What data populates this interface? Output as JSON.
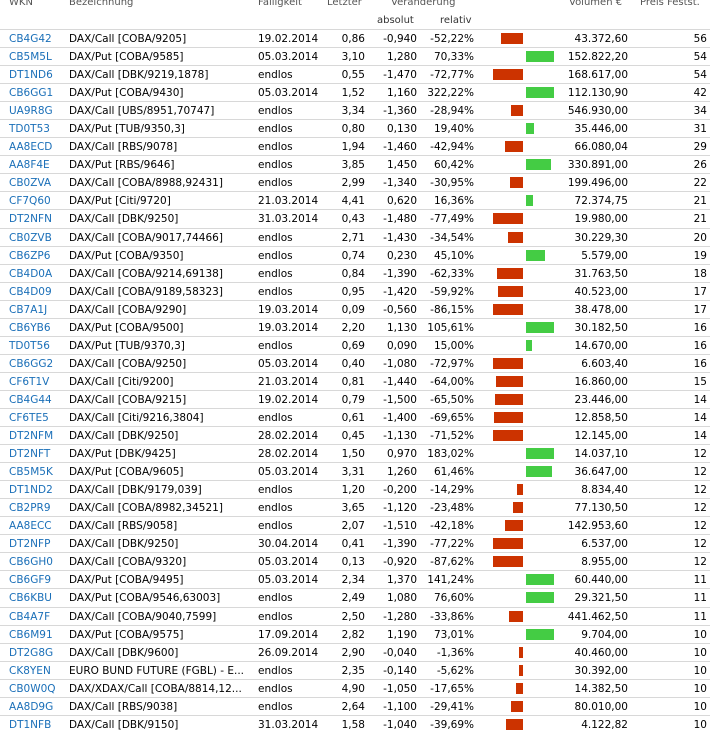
{
  "header": {
    "wkn": "WKN",
    "name": "Bezeichnung",
    "date": "Fälligkeit",
    "last": "Letzter",
    "change": "Veränderung",
    "volume": "Volumen €",
    "fest": "Preis Festst.",
    "abs": "absolut",
    "rel": "relativ"
  },
  "colors": {
    "up": "#44cc44",
    "down": "#cc3300",
    "link": "#1a6fb8"
  },
  "rows": [
    {
      "wkn": "CB4G42",
      "name": "DAX/Call [COBA/9205]",
      "date": "19.02.2014",
      "last": "0,86",
      "abs": "-0,940",
      "rel": "-52,22%",
      "dir": "down",
      "vol": "43.372,60",
      "fest": "56"
    },
    {
      "wkn": "CB5M5L",
      "name": "DAX/Put [COBA/9585]",
      "date": "05.03.2014",
      "last": "3,10",
      "abs": "1,280",
      "rel": "70,33%",
      "dir": "up",
      "vol": "152.822,20",
      "fest": "54"
    },
    {
      "wkn": "DT1ND6",
      "name": "DAX/Call [DBK/9219,1878]",
      "date": "endlos",
      "last": "0,55",
      "abs": "-1,470",
      "rel": "-72,77%",
      "dir": "down",
      "vol": "168.617,00",
      "fest": "54"
    },
    {
      "wkn": "CB6GG1",
      "name": "DAX/Put [COBA/9430]",
      "date": "05.03.2014",
      "last": "1,52",
      "abs": "1,160",
      "rel": "322,22%",
      "dir": "up",
      "vol": "112.130,90",
      "fest": "42"
    },
    {
      "wkn": "UA9R8G",
      "name": "DAX/Call [UBS/8951,70747]",
      "date": "endlos",
      "last": "3,34",
      "abs": "-1,360",
      "rel": "-28,94%",
      "dir": "down",
      "vol": "546.930,00",
      "fest": "34"
    },
    {
      "wkn": "TD0T53",
      "name": "DAX/Put [TUB/9350,3]",
      "date": "endlos",
      "last": "0,80",
      "abs": "0,130",
      "rel": "19,40%",
      "dir": "up",
      "vol": "35.446,00",
      "fest": "31"
    },
    {
      "wkn": "AA8ECD",
      "name": "DAX/Call [RBS/9078]",
      "date": "endlos",
      "last": "1,94",
      "abs": "-1,460",
      "rel": "-42,94%",
      "dir": "down",
      "vol": "66.080,04",
      "fest": "29"
    },
    {
      "wkn": "AA8F4E",
      "name": "DAX/Put [RBS/9646]",
      "date": "endlos",
      "last": "3,85",
      "abs": "1,450",
      "rel": "60,42%",
      "dir": "up",
      "vol": "330.891,00",
      "fest": "26"
    },
    {
      "wkn": "CB0ZVA",
      "name": "DAX/Call [COBA/8988,92431]",
      "date": "endlos",
      "last": "2,99",
      "abs": "-1,340",
      "rel": "-30,95%",
      "dir": "down",
      "vol": "199.496,00",
      "fest": "22"
    },
    {
      "wkn": "CF7Q60",
      "name": "DAX/Put [Citi/9720]",
      "date": "21.03.2014",
      "last": "4,41",
      "abs": "0,620",
      "rel": "16,36%",
      "dir": "up",
      "vol": "72.374,75",
      "fest": "21"
    },
    {
      "wkn": "DT2NFN",
      "name": "DAX/Call [DBK/9250]",
      "date": "31.03.2014",
      "last": "0,43",
      "abs": "-1,480",
      "rel": "-77,49%",
      "dir": "down",
      "vol": "19.980,00",
      "fest": "21"
    },
    {
      "wkn": "CB0ZVB",
      "name": "DAX/Call [COBA/9017,74466]",
      "date": "endlos",
      "last": "2,71",
      "abs": "-1,430",
      "rel": "-34,54%",
      "dir": "down",
      "vol": "30.229,30",
      "fest": "20"
    },
    {
      "wkn": "CB6ZP6",
      "name": "DAX/Put [COBA/9350]",
      "date": "endlos",
      "last": "0,74",
      "abs": "0,230",
      "rel": "45,10%",
      "dir": "up",
      "vol": "5.579,00",
      "fest": "19"
    },
    {
      "wkn": "CB4D0A",
      "name": "DAX/Call [COBA/9214,69138]",
      "date": "endlos",
      "last": "0,84",
      "abs": "-1,390",
      "rel": "-62,33%",
      "dir": "down",
      "vol": "31.763,50",
      "fest": "18"
    },
    {
      "wkn": "CB4D09",
      "name": "DAX/Call [COBA/9189,58323]",
      "date": "endlos",
      "last": "0,95",
      "abs": "-1,420",
      "rel": "-59,92%",
      "dir": "down",
      "vol": "40.523,00",
      "fest": "17"
    },
    {
      "wkn": "CB7A1J",
      "name": "DAX/Call [COBA/9290]",
      "date": "19.03.2014",
      "last": "0,09",
      "abs": "-0,560",
      "rel": "-86,15%",
      "dir": "down",
      "vol": "38.478,00",
      "fest": "17"
    },
    {
      "wkn": "CB6YB6",
      "name": "DAX/Put [COBA/9500]",
      "date": "19.03.2014",
      "last": "2,20",
      "abs": "1,130",
      "rel": "105,61%",
      "dir": "up",
      "vol": "30.182,50",
      "fest": "16"
    },
    {
      "wkn": "TD0T56",
      "name": "DAX/Put [TUB/9370,3]",
      "date": "endlos",
      "last": "0,69",
      "abs": "0,090",
      "rel": "15,00%",
      "dir": "up",
      "vol": "14.670,00",
      "fest": "16"
    },
    {
      "wkn": "CB6GG2",
      "name": "DAX/Call [COBA/9250]",
      "date": "05.03.2014",
      "last": "0,40",
      "abs": "-1,080",
      "rel": "-72,97%",
      "dir": "down",
      "vol": "6.603,40",
      "fest": "16"
    },
    {
      "wkn": "CF6T1V",
      "name": "DAX/Call [Citi/9200]",
      "date": "21.03.2014",
      "last": "0,81",
      "abs": "-1,440",
      "rel": "-64,00%",
      "dir": "down",
      "vol": "16.860,00",
      "fest": "15"
    },
    {
      "wkn": "CB4G44",
      "name": "DAX/Call [COBA/9215]",
      "date": "19.02.2014",
      "last": "0,79",
      "abs": "-1,500",
      "rel": "-65,50%",
      "dir": "down",
      "vol": "23.446,00",
      "fest": "14"
    },
    {
      "wkn": "CF6TE5",
      "name": "DAX/Call [Citi/9216,3804]",
      "date": "endlos",
      "last": "0,61",
      "abs": "-1,400",
      "rel": "-69,65%",
      "dir": "down",
      "vol": "12.858,50",
      "fest": "14"
    },
    {
      "wkn": "DT2NFM",
      "name": "DAX/Call [DBK/9250]",
      "date": "28.02.2014",
      "last": "0,45",
      "abs": "-1,130",
      "rel": "-71,52%",
      "dir": "down",
      "vol": "12.145,00",
      "fest": "14"
    },
    {
      "wkn": "DT2NFT",
      "name": "DAX/Put [DBK/9425]",
      "date": "28.02.2014",
      "last": "1,50",
      "abs": "0,970",
      "rel": "183,02%",
      "dir": "up",
      "vol": "14.037,10",
      "fest": "12"
    },
    {
      "wkn": "CB5M5K",
      "name": "DAX/Put [COBA/9605]",
      "date": "05.03.2014",
      "last": "3,31",
      "abs": "1,260",
      "rel": "61,46%",
      "dir": "up",
      "vol": "36.647,00",
      "fest": "12"
    },
    {
      "wkn": "DT1ND2",
      "name": "DAX/Call [DBK/9179,039]",
      "date": "endlos",
      "last": "1,20",
      "abs": "-0,200",
      "rel": "-14,29%",
      "dir": "down",
      "vol": "8.834,40",
      "fest": "12"
    },
    {
      "wkn": "CB2PR9",
      "name": "DAX/Call [COBA/8982,34521]",
      "date": "endlos",
      "last": "3,65",
      "abs": "-1,120",
      "rel": "-23,48%",
      "dir": "down",
      "vol": "77.130,50",
      "fest": "12"
    },
    {
      "wkn": "AA8ECC",
      "name": "DAX/Call [RBS/9058]",
      "date": "endlos",
      "last": "2,07",
      "abs": "-1,510",
      "rel": "-42,18%",
      "dir": "down",
      "vol": "142.953,60",
      "fest": "12"
    },
    {
      "wkn": "DT2NFP",
      "name": "DAX/Call [DBK/9250]",
      "date": "30.04.2014",
      "last": "0,41",
      "abs": "-1,390",
      "rel": "-77,22%",
      "dir": "down",
      "vol": "6.537,00",
      "fest": "12"
    },
    {
      "wkn": "CB6GH0",
      "name": "DAX/Call [COBA/9320]",
      "date": "05.03.2014",
      "last": "0,13",
      "abs": "-0,920",
      "rel": "-87,62%",
      "dir": "down",
      "vol": "8.955,00",
      "fest": "12"
    },
    {
      "wkn": "CB6GF9",
      "name": "DAX/Put [COBA/9495]",
      "date": "05.03.2014",
      "last": "2,34",
      "abs": "1,370",
      "rel": "141,24%",
      "dir": "up",
      "vol": "60.440,00",
      "fest": "11"
    },
    {
      "wkn": "CB6KBU",
      "name": "DAX/Put [COBA/9546,63003]",
      "date": "endlos",
      "last": "2,49",
      "abs": "1,080",
      "rel": "76,60%",
      "dir": "up",
      "vol": "29.321,50",
      "fest": "11"
    },
    {
      "wkn": "CB4A7F",
      "name": "DAX/Call [COBA/9040,7599]",
      "date": "endlos",
      "last": "2,50",
      "abs": "-1,280",
      "rel": "-33,86%",
      "dir": "down",
      "vol": "441.462,50",
      "fest": "11"
    },
    {
      "wkn": "CB6M91",
      "name": "DAX/Put [COBA/9575]",
      "date": "17.09.2014",
      "last": "2,82",
      "abs": "1,190",
      "rel": "73,01%",
      "dir": "up",
      "vol": "9.704,00",
      "fest": "10"
    },
    {
      "wkn": "DT2G8G",
      "name": "DAX/Call [DBK/9600]",
      "date": "26.09.2014",
      "last": "2,90",
      "abs": "-0,040",
      "rel": "-1,36%",
      "dir": "down",
      "vol": "40.460,00",
      "fest": "10"
    },
    {
      "wkn": "CK8YEN",
      "name": "EURO BUND FUTURE (FGBL) - E...",
      "date": "endlos",
      "last": "2,35",
      "abs": "-0,140",
      "rel": "-5,62%",
      "dir": "down",
      "vol": "30.392,00",
      "fest": "10"
    },
    {
      "wkn": "CB0W0Q",
      "name": "DAX/XDAX/Call [COBA/8814,12...",
      "date": "endlos",
      "last": "4,90",
      "abs": "-1,050",
      "rel": "-17,65%",
      "dir": "down",
      "vol": "14.382,50",
      "fest": "10"
    },
    {
      "wkn": "AA8D9G",
      "name": "DAX/Call [RBS/9038]",
      "date": "endlos",
      "last": "2,64",
      "abs": "-1,100",
      "rel": "-29,41%",
      "dir": "down",
      "vol": "80.010,00",
      "fest": "10"
    },
    {
      "wkn": "DT1NFB",
      "name": "DAX/Call [DBK/9150]",
      "date": "31.03.2014",
      "last": "1,58",
      "abs": "-1,040",
      "rel": "-39,69%",
      "dir": "down",
      "vol": "4.122,82",
      "fest": "10"
    }
  ]
}
